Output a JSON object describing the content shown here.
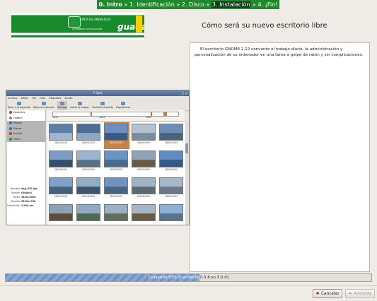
{
  "nav": {
    "steps": [
      "0. Intro",
      "1. Identificación",
      "2. Disco",
      "3. Instalación",
      "4. ¡Fin!"
    ],
    "separator": "»"
  },
  "logo": {
    "line1": "JUNTA DE ANDALUCIA",
    "line2": "CONSEJERÍA DE EDUCACIÓN",
    "brand": "guada"
  },
  "main": {
    "title": "Cómo será su nuevo escritorio libre",
    "body": "El escritorio GNOME 2.12 convierte el trabajo diario, la administración y personalización de su ordenador en una tarea a golpe de ratón y sin complicaciones."
  },
  "screenshot": {
    "window_title": "F-Spot",
    "menu": [
      "Archivo",
      "Editar",
      "Ver",
      "Foto",
      "Etiquetas",
      "Ayuda"
    ],
    "toolbar": [
      "Rotar a la izquierda",
      "Rotar a la derecha",
      "Navegar",
      "Editar la imagen",
      "Pantalla completa",
      "Diapositivas"
    ],
    "tags": [
      {
        "label": "Favoritos",
        "color": "#c0392b"
      },
      {
        "label": "Hidden",
        "color": "#888888"
      },
      {
        "label": "People",
        "color": "#3a6ea5"
      },
      {
        "label": "Places",
        "color": "#3a6ea5"
      },
      {
        "label": "Events",
        "color": "#c0392b"
      },
      {
        "label": "Other",
        "color": "#2e8b2e"
      }
    ],
    "years": [
      "2003",
      "2004",
      "2005"
    ],
    "info": {
      "name_label": "Nombre",
      "name_value": "img_032.jpg",
      "version_label": "Versión",
      "version_value": "Original",
      "date_label": "Fecha",
      "date_value": "28/04/2005",
      "size_label": "Tamaño",
      "size_value": "2592x1728",
      "exposure_label": "Exposición",
      "exposure_value": "1/400 sec"
    },
    "thumbs": [
      {
        "cap": "28/04/2005",
        "c1": "#5d7fa8",
        "c2": "#9fb6cf"
      },
      {
        "cap": "28/04/2005",
        "c1": "#4e6d92",
        "c2": "#8fa8c2"
      },
      {
        "cap": "28/04/2005",
        "c1": "#6b8fc0",
        "c2": "#3a5a84",
        "sel": true
      },
      {
        "cap": "28/04/2005",
        "c1": "#b4c3d3",
        "c2": "#7c8c9c"
      },
      {
        "cap": "28/04/2005",
        "c1": "#6d8fb6",
        "c2": "#4a6480"
      },
      {
        "cap": "28/04/2005",
        "c1": "#7d9cc4",
        "c2": "#35506e"
      },
      {
        "cap": "28/04/2005",
        "c1": "#9cb5cf",
        "c2": "#5a7088"
      },
      {
        "cap": "28/04/2005",
        "c1": "#6a93c6",
        "c2": "#4a6a94"
      },
      {
        "cap": "28/04/2005",
        "c1": "#8ea3b6",
        "c2": "#6b5a48"
      },
      {
        "cap": "28/04/2005",
        "c1": "#5f8bc2",
        "c2": "#2f5a8a"
      },
      {
        "cap": "28/04/2005",
        "c1": "#7fa2c8",
        "c2": "#44627e"
      },
      {
        "cap": "28/04/2005",
        "c1": "#92acc6",
        "c2": "#3d566e"
      },
      {
        "cap": "28/04/2005",
        "c1": "#6e93bf",
        "c2": "#4a6584"
      },
      {
        "cap": "28/04/2005",
        "c1": "#9fb3c4",
        "c2": "#5c6a76"
      },
      {
        "cap": "28/04/2005",
        "c1": "#a8b8c8",
        "c2": "#6b7886"
      },
      {
        "cap": "",
        "c1": "#8aa1b6",
        "c2": "#5b4e3e"
      },
      {
        "cap": "",
        "c1": "#8fa9c6",
        "c2": "#4f6a52"
      },
      {
        "cap": "",
        "c1": "#9bb0c4",
        "c2": "#5e6e5a"
      },
      {
        "cap": "",
        "c1": "#a5b5c4",
        "c2": "#6a5a48"
      },
      {
        "cap": "",
        "c1": "#8fb0d4",
        "c2": "#56748e"
      }
    ]
  },
  "progress": {
    "text": "Copiando 53% [/usr/lib/lib",
    "text_dark": "0-3.8.so.3.0.0]",
    "percent": 53
  },
  "buttons": {
    "cancel": "Cancelar",
    "forward": "Adelante"
  }
}
